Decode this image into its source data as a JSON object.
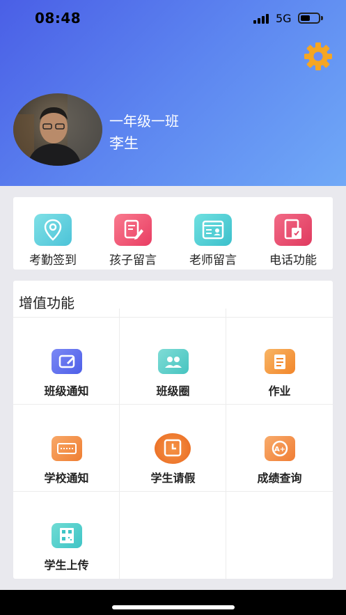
{
  "status_bar": {
    "time": "08:48",
    "network": "5G"
  },
  "profile": {
    "class_name": "一年级一班",
    "user_name": "李生"
  },
  "quick_actions": [
    {
      "label": "考勤签到",
      "icon": "location-pin-icon",
      "color": "#5fcfe0"
    },
    {
      "label": "孩子留言",
      "icon": "edit-note-icon",
      "color": "#f0506e"
    },
    {
      "label": "老师留言",
      "icon": "id-card-icon",
      "color": "#4cd0d4"
    },
    {
      "label": "电话功能",
      "icon": "phone-book-icon",
      "color": "#ef4a6b"
    }
  ],
  "value_added": {
    "title": "增值功能",
    "items": [
      {
        "label": "班级通知",
        "icon": "class-notice-icon",
        "color": "#5a6ff0"
      },
      {
        "label": "班级圈",
        "icon": "class-circle-icon",
        "color": "#5fcfc9"
      },
      {
        "label": "作业",
        "icon": "homework-icon",
        "color": "#f59a3c"
      },
      {
        "label": "学校通知",
        "icon": "school-notice-icon",
        "color": "#f38a3d"
      },
      {
        "label": "学生请假",
        "icon": "leave-clock-icon",
        "color": "#f07a2e"
      },
      {
        "label": "成绩查询",
        "icon": "grade-query-icon",
        "color": "#f48b3f"
      },
      {
        "label": "学生上传",
        "icon": "qr-upload-icon",
        "color": "#4fd0c8"
      }
    ]
  },
  "colors": {
    "header_start": "#4a5fe6",
    "header_end": "#70a9f7",
    "gear": "#f5a623",
    "page_bg": "#e9e9ee"
  }
}
